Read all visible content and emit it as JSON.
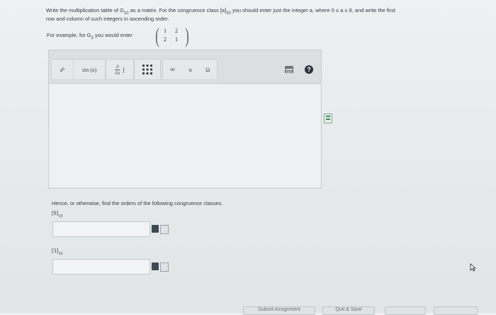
{
  "question": {
    "line1_a": "Write the multiplication table of G",
    "line1_sub": "10",
    "line1_b": "as a matrix. For the congruence class [a]",
    "line1_sub2": "10",
    "line1_c": "you should enter just the integer a, where 0 ≤ a ≤ 9, and write the first",
    "line2": "row and column of such integers in ascending order.",
    "example_a": "For example, for G",
    "example_sub": "3",
    "example_b": "you would enter",
    "matrix": [
      "1",
      "2",
      "2",
      "1"
    ]
  },
  "toolbar": {
    "power": "a",
    "power_sup": "b",
    "sin": "sin (a)",
    "deriv_top": "∂",
    "deriv_bottom": "∂x",
    "integral": "∫",
    "infinity": "∞",
    "alpha": "α",
    "omega": "Ω"
  },
  "part2": {
    "intro": "Hence, or otherwise, find the orders of the following congruence classes.",
    "class1": "[9]",
    "class1_sub": "10",
    "class2": "[3]",
    "class2_sub": "10"
  },
  "footer": {
    "submit": "Submit Assignment",
    "quit": "Quit & Save"
  },
  "colors": {
    "help_icon": "#2b3340",
    "green_icon": "#3f8a5a"
  }
}
